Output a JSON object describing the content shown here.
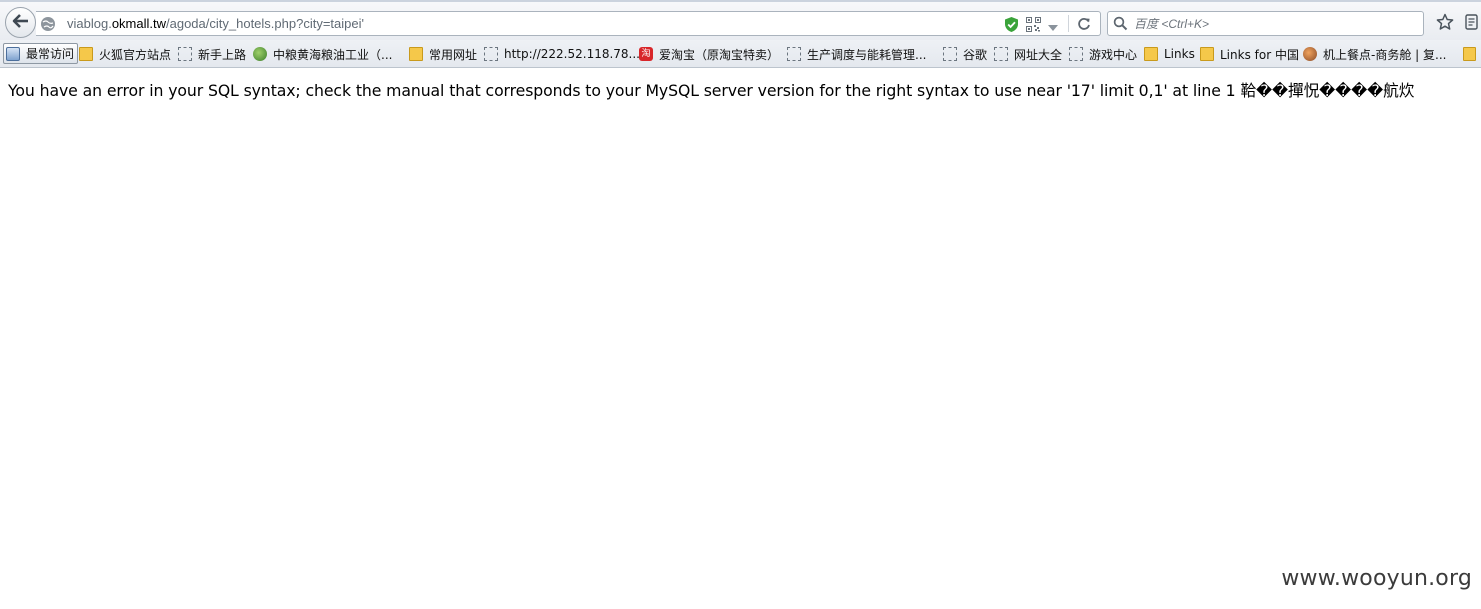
{
  "browser": {
    "url": {
      "prefix": "viablog.",
      "host": "okmall.tw",
      "path": "/agoda/city_hotels.php?city=taipei'"
    },
    "search": {
      "placeholder": "百度 <Ctrl+K>"
    },
    "icons": {
      "back": "back-arrow-icon",
      "site": "globe-icon",
      "security": "shield-check-icon",
      "qr": "qr-code-icon",
      "dropdown": "chevron-down-icon",
      "reload": "reload-icon",
      "search": "search-icon",
      "bookmark": "star-icon",
      "menu": "menu-icon"
    }
  },
  "bookmarks": [
    {
      "label": "最常访问",
      "icon": "app-icon"
    },
    {
      "label": "火狐官方站点",
      "icon": "folder-icon"
    },
    {
      "label": "新手上路",
      "icon": "page-icon"
    },
    {
      "label": "中粮黄海粮油工业（...",
      "icon": "leaf-icon"
    },
    {
      "label": "常用网址",
      "icon": "folder-icon"
    },
    {
      "label": "http://222.52.118.78...",
      "icon": "page-icon"
    },
    {
      "label": "爱淘宝（原淘宝特卖）",
      "icon": "taobao-icon"
    },
    {
      "label": "生产调度与能耗管理...",
      "icon": "page-icon"
    },
    {
      "label": "谷歌",
      "icon": "page-icon"
    },
    {
      "label": "网址大全",
      "icon": "page-icon"
    },
    {
      "label": "游戏中心",
      "icon": "page-icon"
    },
    {
      "label": "Links",
      "icon": "folder-icon"
    },
    {
      "label": "Links for 中国",
      "icon": "folder-icon"
    },
    {
      "label": "机上餐点-商务舱 | 复...",
      "icon": "bird-icon"
    }
  ],
  "page": {
    "error_message": "You have an error in your SQL syntax; check the manual that corresponds to your MySQL server version for the right syntax to use near '17' limit 0,1' at line 1 鞈��撣怳����航炊",
    "watermark": "www.wooyun.org"
  },
  "colors": {
    "folder": "#f5c84a",
    "shield": "#3aa33a",
    "taobao": "#d8262a"
  }
}
